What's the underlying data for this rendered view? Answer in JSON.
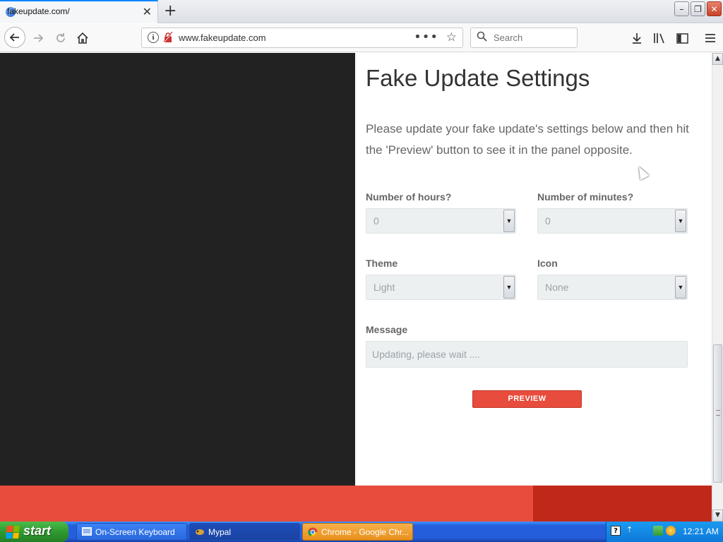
{
  "browser": {
    "tab_title": "fakeupdate.com/",
    "url": "www.fakeupdate.com",
    "search_placeholder": "Search"
  },
  "page": {
    "heading": "Fake Update Settings",
    "intro": "Please update your fake update's settings below and then hit the 'Preview' button to see it in the panel opposite.",
    "hours": {
      "label": "Number of hours?",
      "value": "0"
    },
    "minutes": {
      "label": "Number of minutes?",
      "value": "0"
    },
    "theme": {
      "label": "Theme",
      "value": "Light"
    },
    "icon": {
      "label": "Icon",
      "value": "None"
    },
    "message": {
      "label": "Message",
      "placeholder": "Updating, please wait ...."
    },
    "preview_label": "PREVIEW"
  },
  "taskbar": {
    "start_label": "start",
    "items": [
      {
        "label": "On-Screen Keyboard"
      },
      {
        "label": "Mypal"
      },
      {
        "label": "Chrome - Google Chr..."
      }
    ],
    "clock": "12:21 AM"
  },
  "colors": {
    "accent": "#e74c3c",
    "accent_dark": "#c0291a",
    "dark_panel": "#222222"
  },
  "icons": [
    "back-icon",
    "forward-icon",
    "reload-icon",
    "home-icon",
    "info-icon",
    "insecure-icon",
    "page-actions-icon",
    "bookmark-star-icon",
    "search-icon",
    "downloads-icon",
    "library-icon",
    "sidebar-icon",
    "menu-icon",
    "close-icon",
    "new-tab-icon"
  ]
}
